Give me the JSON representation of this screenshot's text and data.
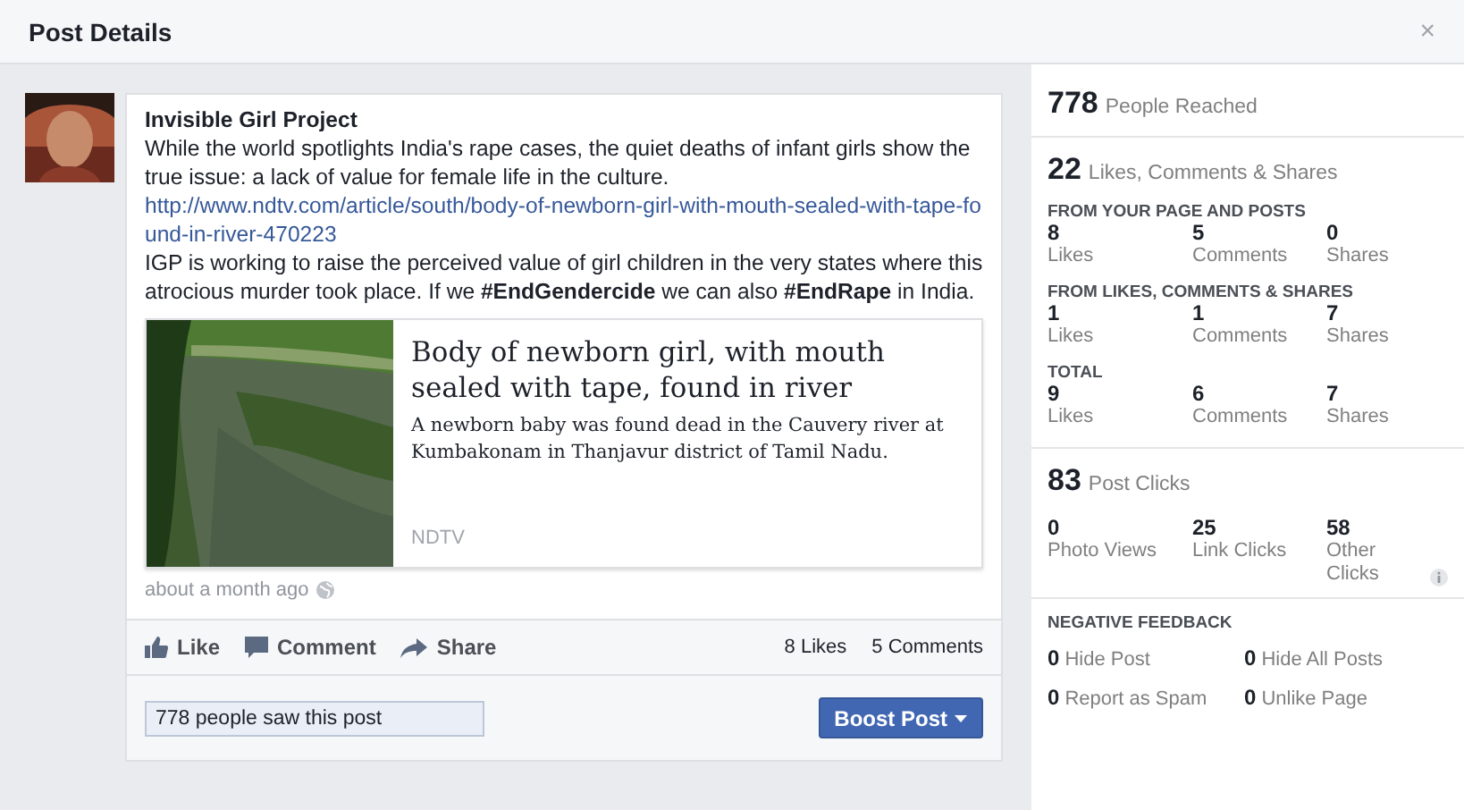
{
  "window": {
    "title": "Post Details",
    "close": "×"
  },
  "post": {
    "author": "Invisible Girl Project",
    "text": "While the world spotlights India's rape cases, the quiet deaths of infant girls show the true issue: a lack of value for female life in the culture.",
    "link": "http://www.ndtv.com/article/south/body-of-newborn-girl-with-mouth-sealed-with-tape-found-in-river-470223",
    "text2": "IGP is working to raise the perceived value of girl children in the very states where this atrocious murder took place. If we **#EndGendercide** we can also **#EndRape** in India.",
    "preview": {
      "title": "Body of newborn girl, with mouth sealed with tape, found in river",
      "description": "A newborn baby was found dead in the Cauvery river at Kumbakonam in Thanjavur district of Tamil Nadu.",
      "source": "NDTV"
    },
    "time": "about a month ago",
    "actions": [
      {
        "kind": "like",
        "label": "Like"
      },
      {
        "kind": "comment",
        "label": "Comment"
      },
      {
        "kind": "share",
        "label": "Share"
      }
    ],
    "counts": [
      "8 Likes",
      "5 Comments"
    ],
    "reach": "778 people saw this post",
    "boost": "Boost Post"
  },
  "stats": {
    "reached": {
      "value": "778",
      "label": "People Reached"
    },
    "engagement": {
      "value": "22",
      "label": "Likes, Comments & Shares",
      "groups": [
        {
          "title": "FROM YOUR PAGE AND POSTS",
          "items": [
            {
              "value": "8",
              "label": "Likes"
            },
            {
              "value": "5",
              "label": "Comments"
            },
            {
              "value": "0",
              "label": "Shares"
            }
          ]
        },
        {
          "title": "FROM LIKES, COMMENTS & SHARES",
          "items": [
            {
              "value": "1",
              "label": "Likes"
            },
            {
              "value": "1",
              "label": "Comments"
            },
            {
              "value": "7",
              "label": "Shares"
            }
          ]
        },
        {
          "title": "TOTAL",
          "items": [
            {
              "value": "9",
              "label": "Likes"
            },
            {
              "value": "6",
              "label": "Comments"
            },
            {
              "value": "7",
              "label": "Shares"
            }
          ]
        }
      ]
    },
    "clicks": {
      "value": "83",
      "label": "Post Clicks",
      "items": [
        {
          "value": "0",
          "label": "Photo Views"
        },
        {
          "value": "25",
          "label": "Link Clicks"
        },
        {
          "value": "58",
          "label": "Other Clicks"
        }
      ]
    },
    "negative": {
      "title": "NEGATIVE FEEDBACK",
      "items": [
        {
          "value": "0",
          "label": "Hide Post"
        },
        {
          "value": "0",
          "label": "Hide All Posts"
        },
        {
          "value": "0",
          "label": "Report as Spam"
        },
        {
          "value": "0",
          "label": "Unlike Page"
        }
      ]
    }
  }
}
